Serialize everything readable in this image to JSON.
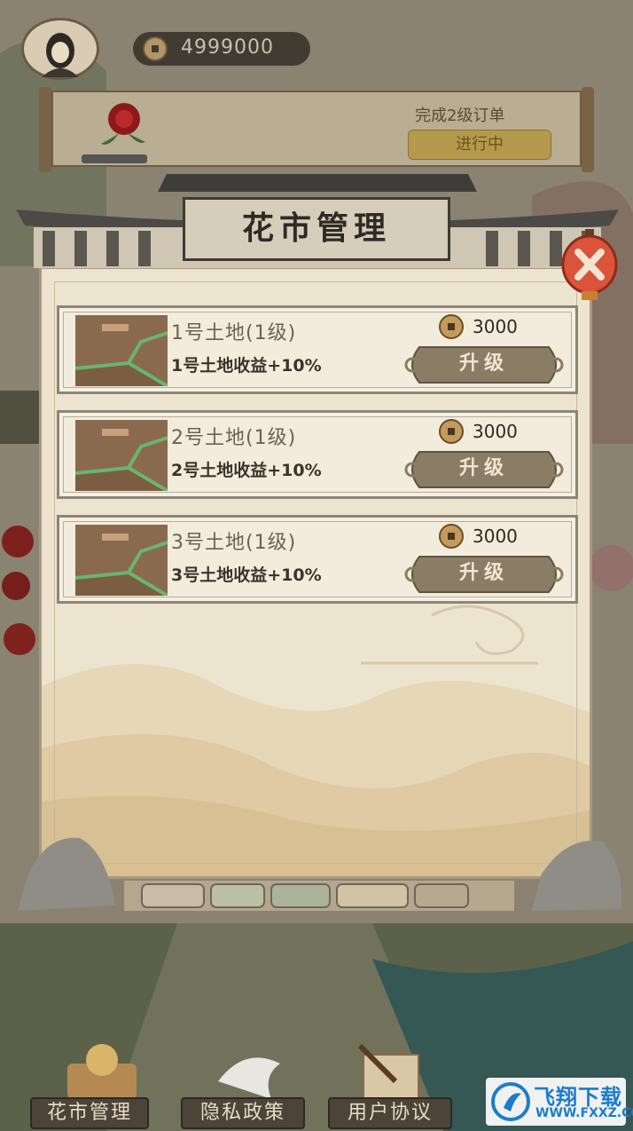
{
  "hud": {
    "coins": "4999000"
  },
  "order": {
    "description": "完成2级订单",
    "status_button": "进行中"
  },
  "dialog": {
    "title": "花市管理",
    "lands": [
      {
        "name": "1号土地(1级)",
        "bonus": "1号土地收益+10%",
        "cost": "3000",
        "button": "升级"
      },
      {
        "name": "2号土地(1级)",
        "bonus": "2号土地收益+10%",
        "cost": "3000",
        "button": "升级"
      },
      {
        "name": "3号土地(1级)",
        "bonus": "3号土地收益+10%",
        "cost": "3000",
        "button": "升级"
      }
    ]
  },
  "nav": {
    "items": [
      {
        "label": "花市管理"
      },
      {
        "label": "隐私政策"
      },
      {
        "label": "用户协议"
      }
    ]
  },
  "watermark": {
    "title": "飞翔下载",
    "url": "WWW.FXXZ.COM"
  },
  "colors": {
    "upgrade_button": "#8a7d66",
    "close_button": "#d9543a",
    "title_plate": "#d6cdbb",
    "watermark_blue": "#1f7cc9"
  }
}
